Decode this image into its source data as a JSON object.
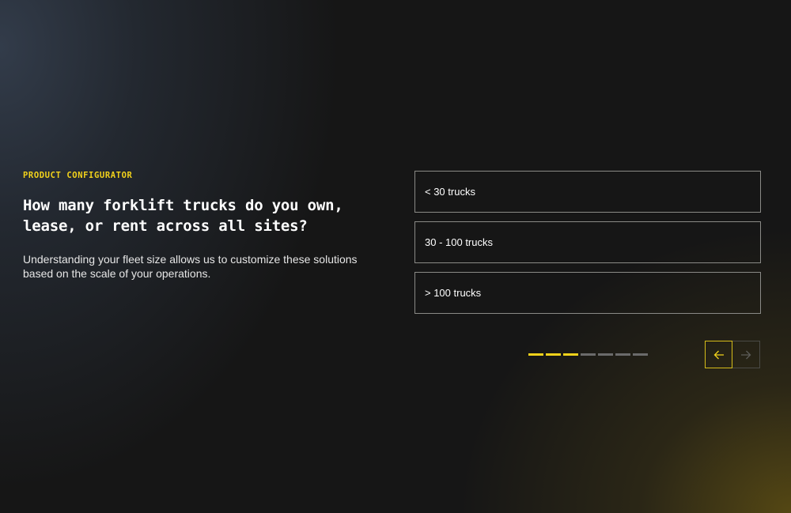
{
  "configurator": {
    "eyebrow": "PRODUCT CONFIGURATOR",
    "question": "How many forklift trucks do you own, lease, or rent across all sites?",
    "description": "Understanding your fleet size allows us to customize these solutions based on the scale of your operations."
  },
  "options": [
    {
      "label": "< 30 trucks"
    },
    {
      "label": "30 - 100 trucks"
    },
    {
      "label": "> 100 trucks"
    }
  ],
  "progress": {
    "current_step": 3,
    "total_steps": 7
  },
  "navigation": {
    "prev_icon": "arrow-left-icon",
    "next_icon": "arrow-right-icon",
    "prev_enabled": true,
    "next_enabled": false
  },
  "colors": {
    "accent": "#f2d21b",
    "option_border": "#8a8a86",
    "inactive_segment": "#6b6b6b",
    "background": "#161616"
  }
}
